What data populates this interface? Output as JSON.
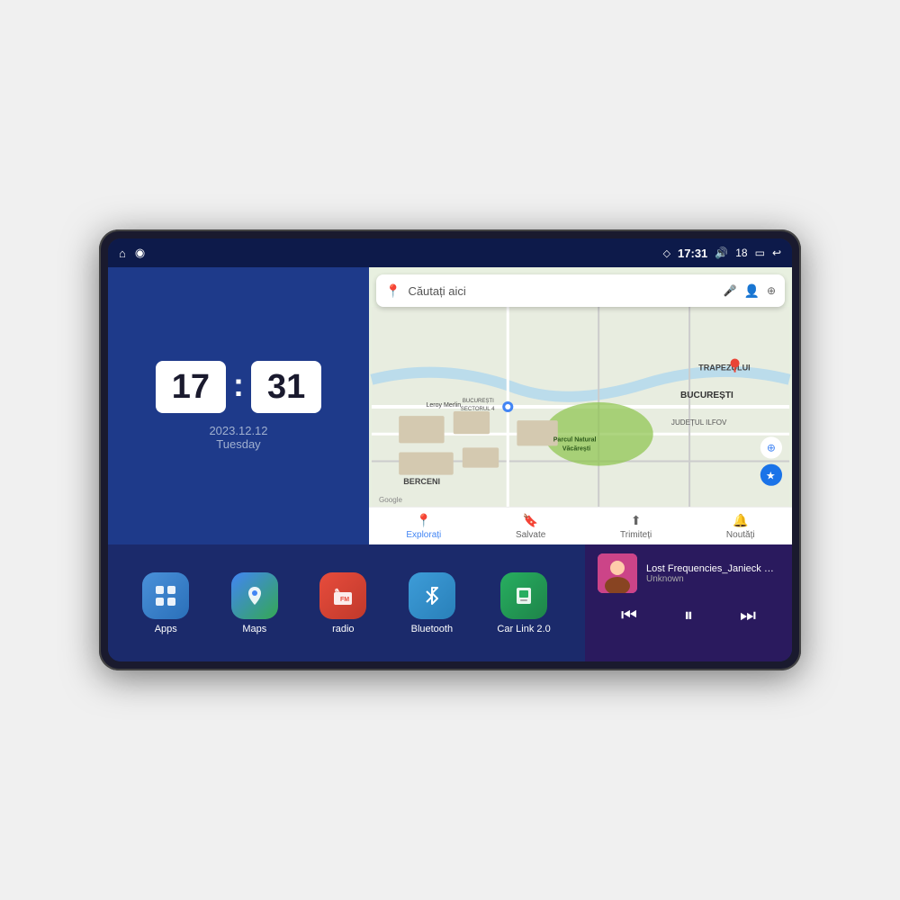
{
  "device": {
    "status_bar": {
      "location_icon": "◇",
      "time": "17:31",
      "volume_icon": "🔊",
      "volume_level": "18",
      "battery_icon": "▭",
      "back_icon": "↩",
      "home_icon": "⌂",
      "nav_icon": "◉"
    },
    "clock": {
      "hour": "17",
      "minute": "31",
      "date": "2023.12.12",
      "day": "Tuesday"
    },
    "map": {
      "search_placeholder": "Căutați aici",
      "nav_items": [
        {
          "label": "Explorați",
          "active": true
        },
        {
          "label": "Salvate",
          "active": false
        },
        {
          "label": "Trimiteți",
          "active": false
        },
        {
          "label": "Noutăți",
          "active": false
        }
      ],
      "labels": [
        "TRAPEZULUI",
        "BUCUREȘTI",
        "JUDEȚUL ILFOV",
        "BERCENI",
        "Parcul Natural Văcărești",
        "Leroy Merlin",
        "BUCUREȘTI SECTORUL 4"
      ]
    },
    "apps": [
      {
        "id": "apps",
        "label": "Apps",
        "icon_class": "icon-apps",
        "icon": "⊞"
      },
      {
        "id": "maps",
        "label": "Maps",
        "icon_class": "icon-maps",
        "icon": "📍"
      },
      {
        "id": "radio",
        "label": "radio",
        "icon_class": "icon-radio",
        "icon": "📻"
      },
      {
        "id": "bluetooth",
        "label": "Bluetooth",
        "icon_class": "icon-bluetooth",
        "icon": "⌾"
      },
      {
        "id": "carlink",
        "label": "Car Link 2.0",
        "icon_class": "icon-carlink",
        "icon": "📱"
      }
    ],
    "music": {
      "title": "Lost Frequencies_Janieck Devy-...",
      "artist": "Unknown",
      "prev_icon": "⏮",
      "play_icon": "⏸",
      "next_icon": "⏭"
    }
  }
}
